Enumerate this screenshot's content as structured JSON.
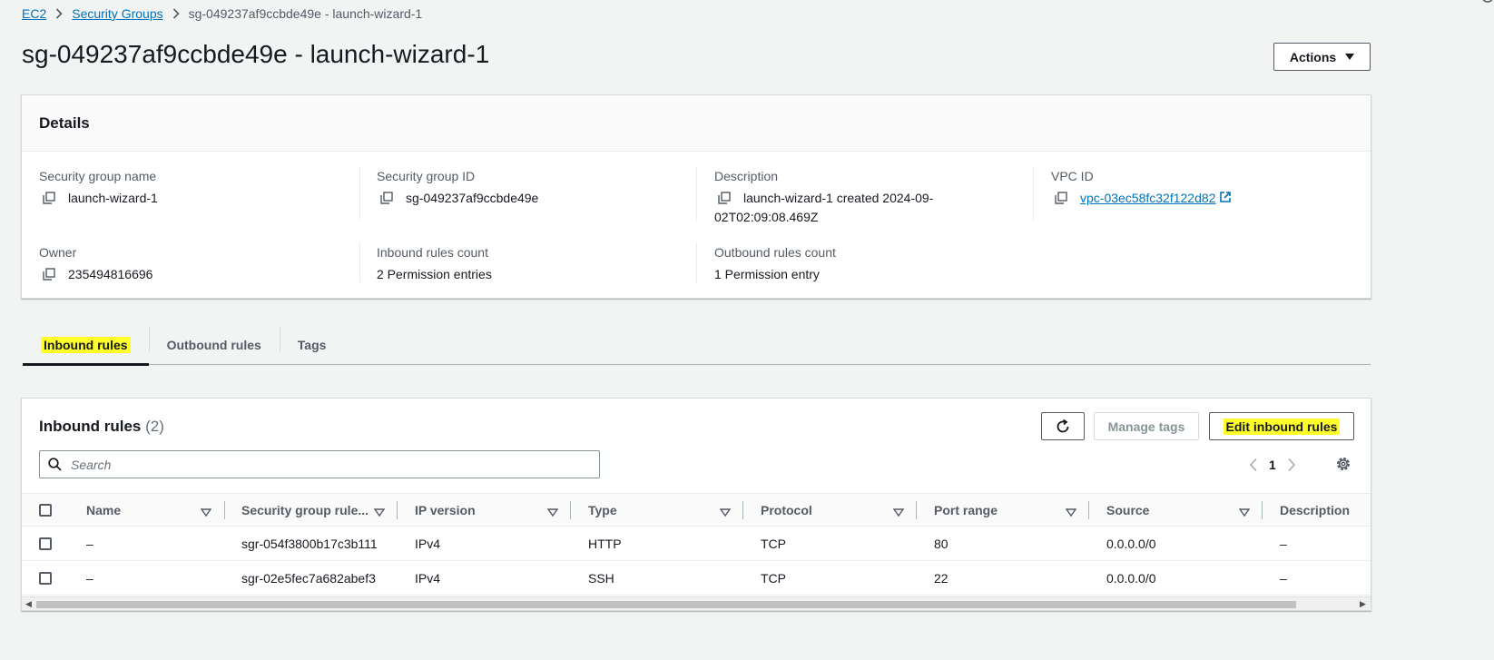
{
  "breadcrumb": {
    "ec2": "EC2",
    "security_groups": "Security Groups",
    "current": "sg-049237af9ccbde49e - launch-wizard-1"
  },
  "page_title": "sg-049237af9ccbde49e - launch-wizard-1",
  "actions_label": "Actions",
  "details": {
    "title": "Details",
    "sg_name_label": "Security group name",
    "sg_name_value": "launch-wizard-1",
    "sg_id_label": "Security group ID",
    "sg_id_value": "sg-049237af9ccbde49e",
    "description_label": "Description",
    "description_value_line1": "launch-wizard-1 created 2024-09-",
    "description_value_line2": "02T02:09:08.469Z",
    "vpc_label": "VPC ID",
    "vpc_value": "vpc-03ec58fc32f122d82",
    "owner_label": "Owner",
    "owner_value": "235494816696",
    "inbound_count_label": "Inbound rules count",
    "inbound_count_value": "2 Permission entries",
    "outbound_count_label": "Outbound rules count",
    "outbound_count_value": "1 Permission entry"
  },
  "tabs": [
    "Inbound rules",
    "Outbound rules",
    "Tags"
  ],
  "rules": {
    "title": "Inbound rules",
    "count": "(2)",
    "manage_tags": "Manage tags",
    "edit_inbound": "Edit inbound rules",
    "search_placeholder": "Search",
    "page": "1",
    "columns": [
      "Name",
      "Security group rule...",
      "IP version",
      "Type",
      "Protocol",
      "Port range",
      "Source",
      "Description"
    ],
    "rows": [
      [
        "–",
        "sgr-054f3800b17c3b111",
        "IPv4",
        "HTTP",
        "TCP",
        "80",
        "0.0.0.0/0",
        "–"
      ],
      [
        "–",
        "sgr-02e5fec7a682abef3",
        "IPv4",
        "SSH",
        "TCP",
        "22",
        "0.0.0.0/0",
        "–"
      ]
    ]
  },
  "colors": {
    "link": "#0073bb",
    "highlight": "#ffff2a",
    "background": "#f2f3f3"
  },
  "icons": [
    "chevron-right-icon",
    "caret-down-icon",
    "copy-icon",
    "external-link-icon",
    "refresh-icon",
    "search-icon",
    "chevron-left-icon",
    "settings-gear-icon",
    "sort-icon"
  ]
}
